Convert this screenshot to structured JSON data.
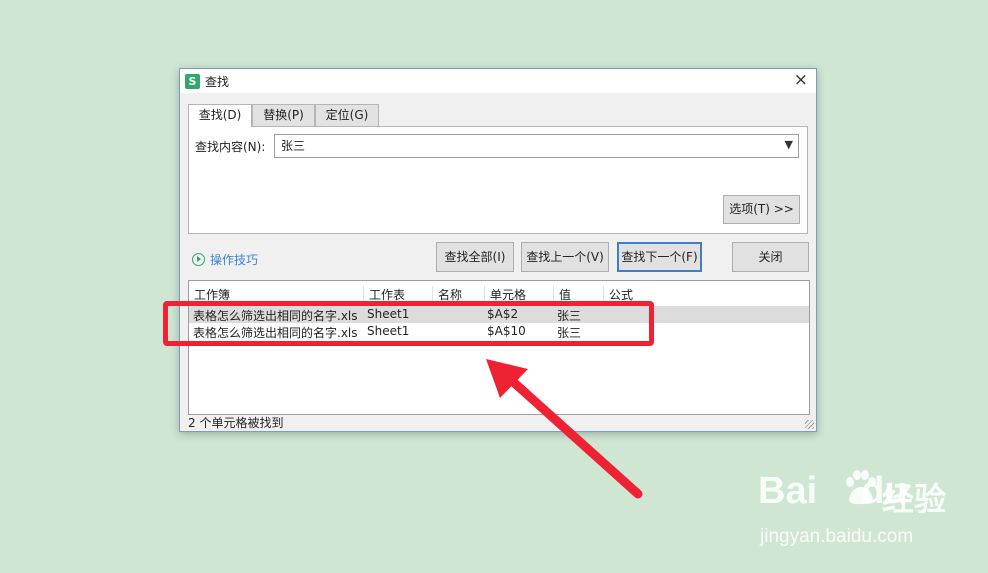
{
  "window": {
    "title": "查找",
    "app_icon": "S",
    "close_glyph": "×"
  },
  "tabs": [
    {
      "label": "查找(D)",
      "active": true
    },
    {
      "label": "替换(P)",
      "active": false
    },
    {
      "label": "定位(G)",
      "active": false
    }
  ],
  "find": {
    "label": "查找内容(N):",
    "value": "张三"
  },
  "options_button": "选项(T) >>",
  "tips_link": "操作技巧",
  "buttons": {
    "find_all": "查找全部(I)",
    "find_prev": "查找上一个(V)",
    "find_next": "查找下一个(F)",
    "close": "关闭"
  },
  "results": {
    "columns": [
      "工作簿",
      "工作表",
      "名称",
      "单元格",
      "值",
      "公式"
    ],
    "rows": [
      [
        "表格怎么筛选出相同的名字.xls",
        "Sheet1",
        "",
        "$A$2",
        "张三",
        ""
      ],
      [
        "表格怎么筛选出相同的名字.xls",
        "Sheet1",
        "",
        "$A$10",
        "张三",
        ""
      ]
    ]
  },
  "status": "2 个单元格被找到",
  "annotation": {
    "color": "#ee2233"
  },
  "watermark": {
    "brand_latin_1": "Bai",
    "brand_latin_2": "du",
    "brand_cn": "经验",
    "url": "jingyan.baidu.com"
  }
}
